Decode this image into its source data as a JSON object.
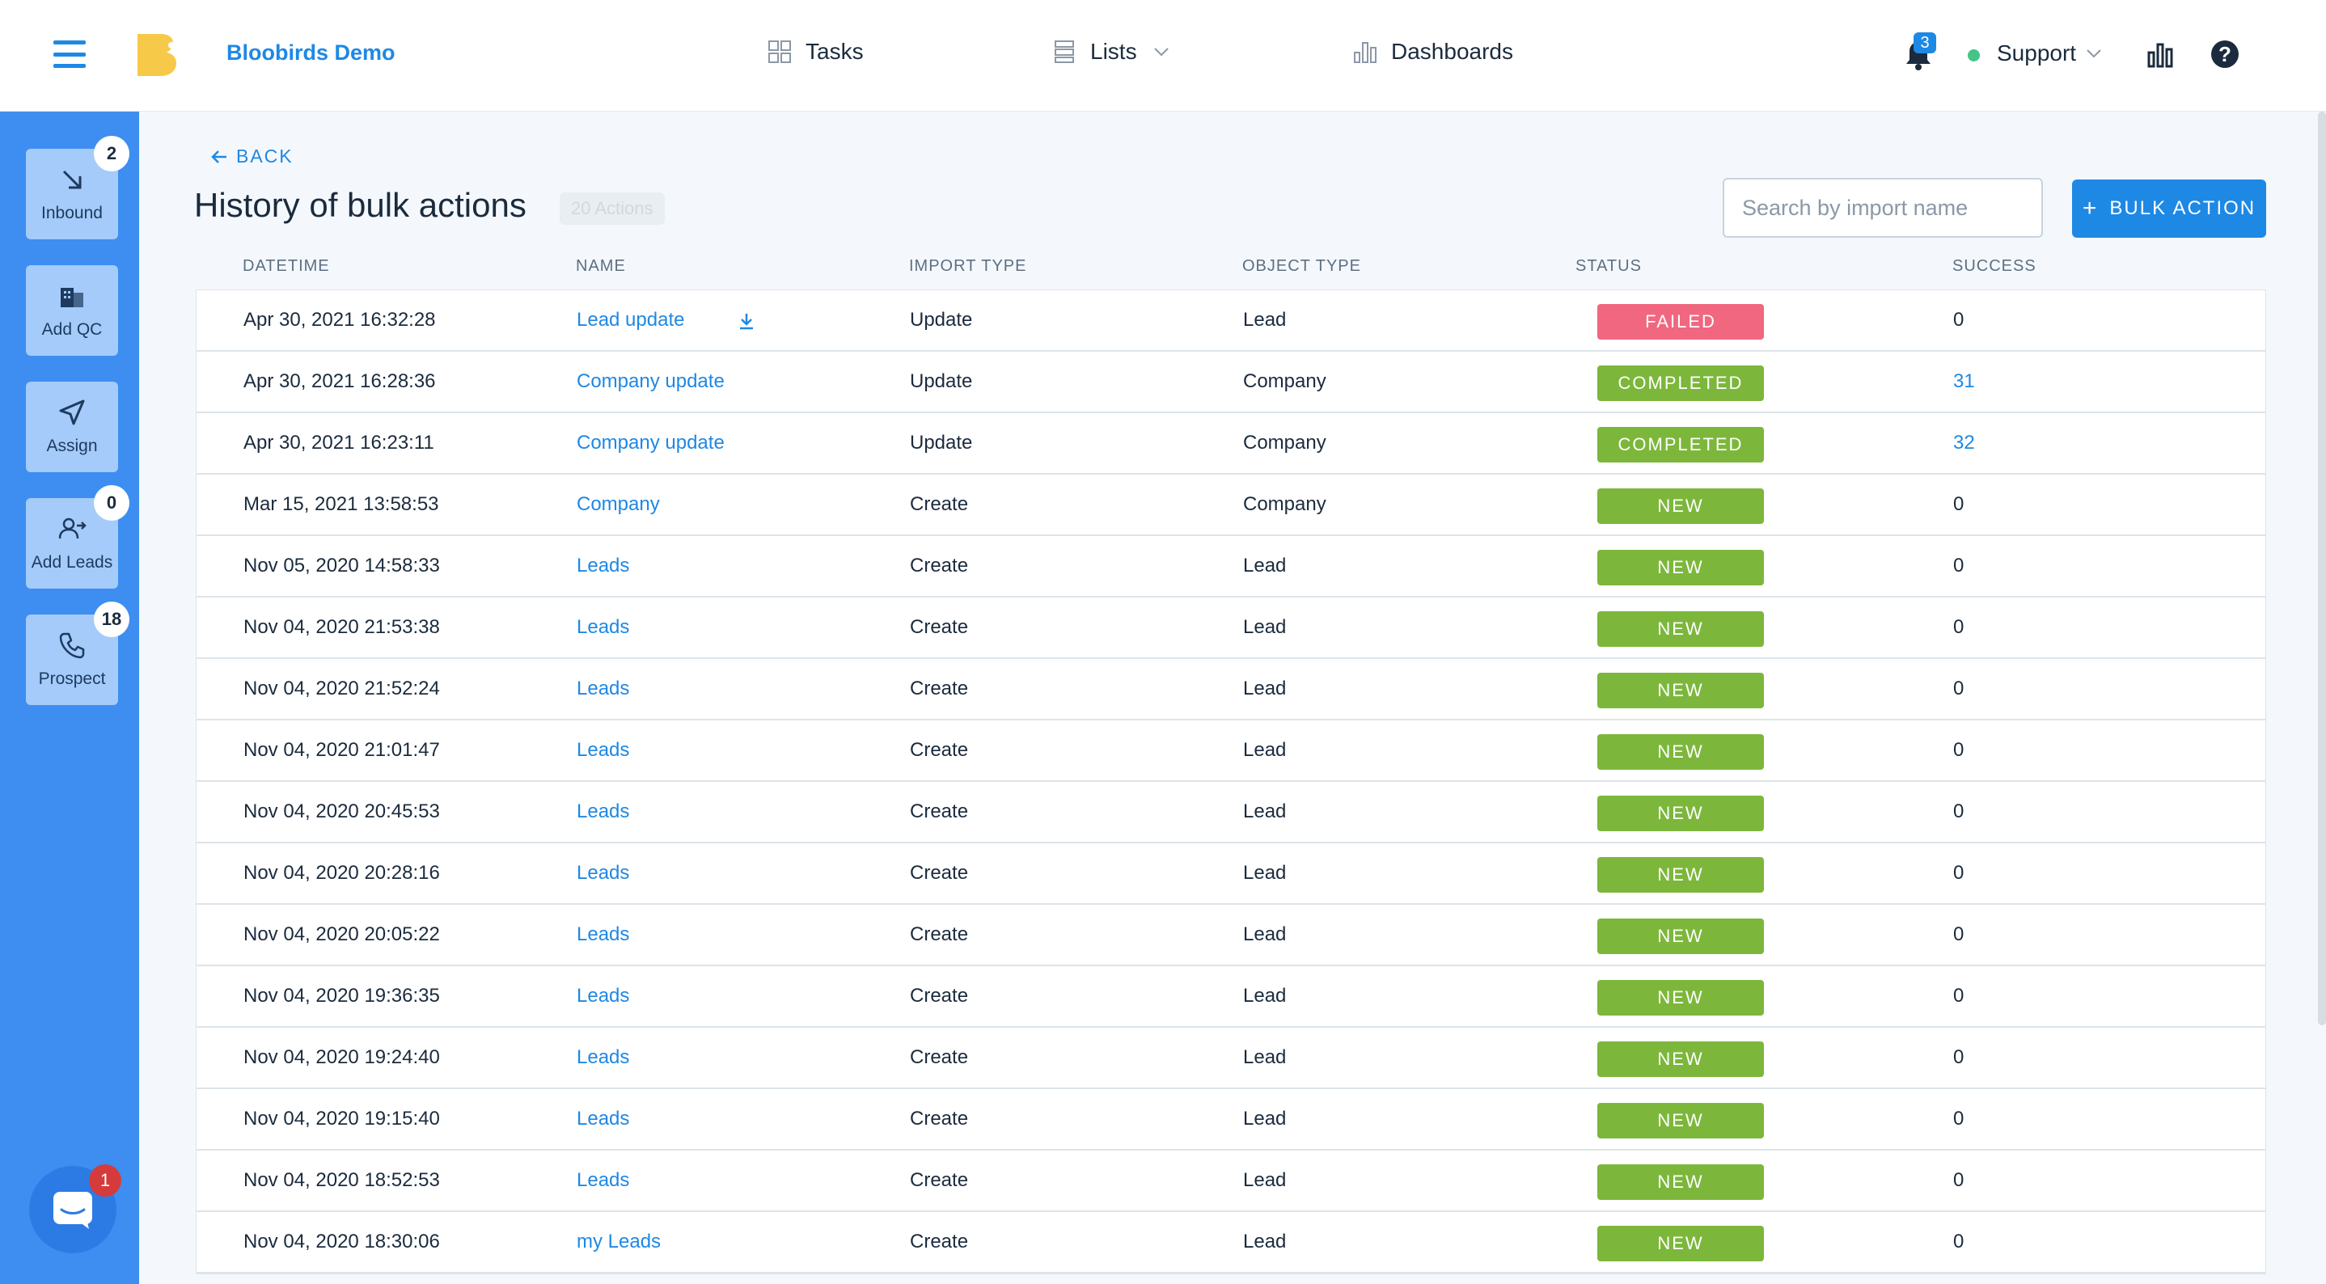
{
  "header": {
    "brand": "Bloobirds Demo",
    "nav": [
      {
        "label": "Tasks",
        "icon": "grid-icon"
      },
      {
        "label": "Lists",
        "icon": "list-icon"
      },
      {
        "label": "Dashboards",
        "icon": "bar-chart-icon"
      }
    ],
    "notifications_count": "3",
    "user_label": "Support",
    "status_color": "#44c486"
  },
  "sidebar": {
    "items": [
      {
        "label": "Inbound",
        "badge": "2",
        "icon": "arrow-down-right-icon"
      },
      {
        "label": "Add QC",
        "badge": "",
        "icon": "building-icon"
      },
      {
        "label": "Assign",
        "badge": "",
        "icon": "send-icon"
      },
      {
        "label": "Add Leads",
        "badge": "0",
        "icon": "add-user-icon"
      },
      {
        "label": "Prospect",
        "badge": "18",
        "icon": "phone-icon"
      }
    ],
    "chat_badge": "1"
  },
  "page": {
    "back_label": "BACK",
    "title": "History of bulk actions",
    "count_badge": "20 Actions",
    "search_placeholder": "Search by import name",
    "bulk_action_label": "BULK ACTION"
  },
  "table": {
    "columns": [
      "DATETIME",
      "NAME",
      "IMPORT TYPE",
      "OBJECT TYPE",
      "STATUS",
      "SUCCESS"
    ],
    "status_colors": {
      "FAILED": "#f0677f",
      "COMPLETED": "#7cb73b",
      "NEW": "#7cb73b"
    },
    "rows": [
      {
        "datetime": "Apr 30, 2021 16:32:28",
        "name": "Lead update",
        "import_type": "Update",
        "object_type": "Lead",
        "status": "FAILED",
        "success": "0"
      },
      {
        "datetime": "Apr 30, 2021 16:28:36",
        "name": "Company update",
        "import_type": "Update",
        "object_type": "Company",
        "status": "COMPLETED",
        "success": "31"
      },
      {
        "datetime": "Apr 30, 2021 16:23:11",
        "name": "Company update",
        "import_type": "Update",
        "object_type": "Company",
        "status": "COMPLETED",
        "success": "32"
      },
      {
        "datetime": "Mar 15, 2021 13:58:53",
        "name": "Company",
        "import_type": "Create",
        "object_type": "Company",
        "status": "NEW",
        "success": "0"
      },
      {
        "datetime": "Nov 05, 2020 14:58:33",
        "name": "Leads",
        "import_type": "Create",
        "object_type": "Lead",
        "status": "NEW",
        "success": "0"
      },
      {
        "datetime": "Nov 04, 2020 21:53:38",
        "name": "Leads",
        "import_type": "Create",
        "object_type": "Lead",
        "status": "NEW",
        "success": "0"
      },
      {
        "datetime": "Nov 04, 2020 21:52:24",
        "name": "Leads",
        "import_type": "Create",
        "object_type": "Lead",
        "status": "NEW",
        "success": "0"
      },
      {
        "datetime": "Nov 04, 2020 21:01:47",
        "name": "Leads",
        "import_type": "Create",
        "object_type": "Lead",
        "status": "NEW",
        "success": "0"
      },
      {
        "datetime": "Nov 04, 2020 20:45:53",
        "name": "Leads",
        "import_type": "Create",
        "object_type": "Lead",
        "status": "NEW",
        "success": "0"
      },
      {
        "datetime": "Nov 04, 2020 20:28:16",
        "name": "Leads",
        "import_type": "Create",
        "object_type": "Lead",
        "status": "NEW",
        "success": "0"
      },
      {
        "datetime": "Nov 04, 2020 20:05:22",
        "name": "Leads",
        "import_type": "Create",
        "object_type": "Lead",
        "status": "NEW",
        "success": "0"
      },
      {
        "datetime": "Nov 04, 2020 19:36:35",
        "name": "Leads",
        "import_type": "Create",
        "object_type": "Lead",
        "status": "NEW",
        "success": "0"
      },
      {
        "datetime": "Nov 04, 2020 19:24:40",
        "name": "Leads",
        "import_type": "Create",
        "object_type": "Lead",
        "status": "NEW",
        "success": "0"
      },
      {
        "datetime": "Nov 04, 2020 19:15:40",
        "name": "Leads",
        "import_type": "Create",
        "object_type": "Lead",
        "status": "NEW",
        "success": "0"
      },
      {
        "datetime": "Nov 04, 2020 18:52:53",
        "name": "Leads",
        "import_type": "Create",
        "object_type": "Lead",
        "status": "NEW",
        "success": "0"
      },
      {
        "datetime": "Nov 04, 2020 18:30:06",
        "name": "my Leads",
        "import_type": "Create",
        "object_type": "Lead",
        "status": "NEW",
        "success": "0"
      }
    ]
  }
}
